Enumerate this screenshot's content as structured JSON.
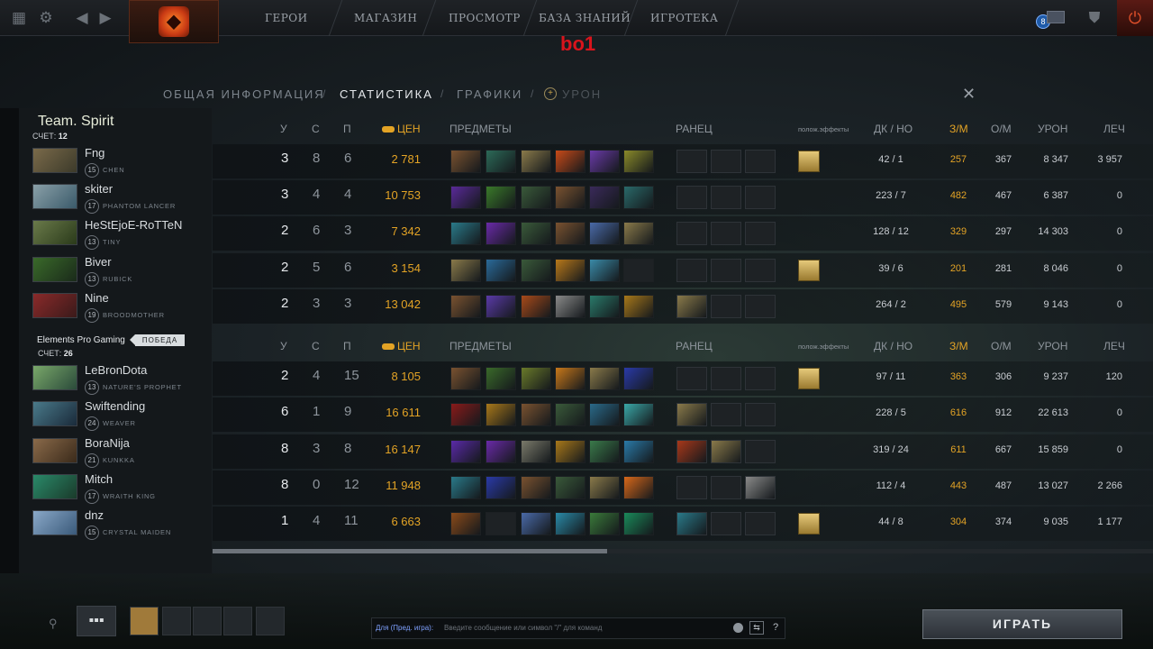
{
  "nav": {
    "items": [
      "ГЕРОИ",
      "МАГАЗИН",
      "ПРОСМОТР",
      "БАЗА ЗНАНИЙ",
      "ИГРОТЕКА"
    ],
    "notification_count": "8"
  },
  "overlay_text": "bo1",
  "tabs": [
    "ОБЩАЯ ИНФОРМАЦИЯ",
    "СТАТИСТИКА",
    "ГРАФИКИ",
    "УРОН"
  ],
  "headers": {
    "k": "У",
    "d": "С",
    "a": "П",
    "nw": "ЦЕН",
    "items": "ПРЕДМЕТЫ",
    "backpack": "РАНЕЦ",
    "effects": "полож.эффекты",
    "lh_dn": "ДК / НО",
    "gpm": "З/М",
    "xpm": "О/М",
    "dmg": "УРОН",
    "heal": "ЛЕЧ"
  },
  "team1": {
    "name": "Team. Spirit",
    "score_label": "СЧЕТ:",
    "score": "12",
    "players": [
      {
        "name": "Fng",
        "level": "15",
        "hero": "CHEN",
        "k": "3",
        "d": "8",
        "a": "6",
        "nw": "2 781",
        "lh": "42",
        "dn": "1",
        "gpm": "257",
        "xpm": "367",
        "dmg": "8 347",
        "heal": "3 957",
        "items": [
          "#7a5230",
          "#2c6a58",
          "#8a7a4a",
          "#c84a18",
          "#6a3aa8",
          "#8a8a2a"
        ],
        "backpack": [
          "",
          "",
          ""
        ],
        "effect": true
      },
      {
        "name": "skiter",
        "level": "17",
        "hero": "PHANTOM LANCER",
        "k": "3",
        "d": "4",
        "a": "4",
        "nw": "10 753",
        "lh": "223",
        "dn": "7",
        "gpm": "482",
        "xpm": "467",
        "dmg": "6 387",
        "heal": "0",
        "items": [
          "#5a2a9a",
          "#3a7a2a",
          "#3a5a3a",
          "#7a5230",
          "#3a2a5a",
          "#2a6a6a"
        ],
        "backpack": [
          "",
          "",
          ""
        ],
        "effect": false
      },
      {
        "name": "HeStEjoE-RoTTeN",
        "level": "13",
        "hero": "TINY",
        "k": "2",
        "d": "6",
        "a": "3",
        "nw": "7 342",
        "lh": "128",
        "dn": "12",
        "gpm": "329",
        "xpm": "297",
        "dmg": "14 303",
        "heal": "0",
        "items": [
          "#2a7a8a",
          "#6a2aa8",
          "#3a5a3a",
          "#7a5230",
          "#4a6aa8",
          "#8a7a4a"
        ],
        "backpack": [
          "",
          "",
          ""
        ],
        "effect": false
      },
      {
        "name": "Biver",
        "level": "13",
        "hero": "RUBICK",
        "k": "2",
        "d": "5",
        "a": "6",
        "nw": "3 154",
        "lh": "39",
        "dn": "6",
        "gpm": "201",
        "xpm": "281",
        "dmg": "8 046",
        "heal": "0",
        "items": [
          "#8a7a4a",
          "#2a6a9a",
          "#3a5a3a",
          "#b8781a",
          "#3a8aa8",
          ""
        ],
        "backpack": [
          "",
          "",
          ""
        ],
        "effect": true
      },
      {
        "name": "Nine",
        "level": "19",
        "hero": "BROODMOTHER",
        "k": "2",
        "d": "3",
        "a": "3",
        "nw": "13 042",
        "lh": "264",
        "dn": "2",
        "gpm": "495",
        "xpm": "579",
        "dmg": "9 143",
        "heal": "0",
        "items": [
          "#7a5230",
          "#5a3aa8",
          "#a84a1a",
          "#8a8a8a",
          "#2a7a6a",
          "#a8781a"
        ],
        "backpack": [
          "#8a7a4a",
          "",
          ""
        ],
        "effect": false
      }
    ]
  },
  "team2": {
    "name": "Elements Pro Gaming",
    "winner_badge": "ПОБЕДА",
    "score_label": "СЧЕТ:",
    "score": "26",
    "players": [
      {
        "name": "LeBronDota",
        "level": "13",
        "hero": "NATURE'S PROPHET",
        "k": "2",
        "d": "4",
        "a": "15",
        "nw": "8 105",
        "lh": "97",
        "dn": "11",
        "gpm": "363",
        "xpm": "306",
        "dmg": "9 237",
        "heal": "120",
        "items": [
          "#7a5230",
          "#3a6a2a",
          "#6a7a2a",
          "#c8781a",
          "#8a7a4a",
          "#2a3aa8"
        ],
        "backpack": [
          "",
          "",
          ""
        ],
        "effect": true
      },
      {
        "name": "Swiftending",
        "level": "24",
        "hero": "WEAVER",
        "k": "6",
        "d": "1",
        "a": "9",
        "nw": "16 611",
        "lh": "228",
        "dn": "5",
        "gpm": "616",
        "xpm": "912",
        "dmg": "22 613",
        "heal": "0",
        "items": [
          "#8a1a1a",
          "#a8781a",
          "#7a5230",
          "#3a5a3a",
          "#2a6a8a",
          "#3aa8a8"
        ],
        "backpack": [
          "#8a7a4a",
          "",
          ""
        ],
        "effect": false
      },
      {
        "name": "BoraNija",
        "level": "21",
        "hero": "KUNKKA",
        "k": "8",
        "d": "3",
        "a": "8",
        "nw": "16 147",
        "lh": "319",
        "dn": "24",
        "gpm": "611",
        "xpm": "667",
        "dmg": "15 859",
        "heal": "0",
        "items": [
          "#5a2aa8",
          "#6a2aa8",
          "#7a7a6a",
          "#a8781a",
          "#3a7a4a",
          "#2a7aa8"
        ],
        "backpack": [
          "#a8381a",
          "#8a7a4a",
          ""
        ],
        "effect": false
      },
      {
        "name": "Mitch",
        "level": "17",
        "hero": "WRAITH KING",
        "k": "8",
        "d": "0",
        "a": "12",
        "nw": "11 948",
        "lh": "112",
        "dn": "4",
        "gpm": "443",
        "xpm": "487",
        "dmg": "13 027",
        "heal": "2 266",
        "items": [
          "#2a7a8a",
          "#2a3aa8",
          "#7a5230",
          "#3a5a3a",
          "#8a7a4a",
          "#d8681a"
        ],
        "backpack": [
          "",
          "",
          "#8a8a8a"
        ],
        "effect": false
      },
      {
        "name": "dnz",
        "level": "15",
        "hero": "CRYSTAL MAIDEN",
        "k": "1",
        "d": "4",
        "a": "11",
        "nw": "6 663",
        "lh": "44",
        "dn": "8",
        "gpm": "304",
        "xpm": "374",
        "dmg": "9 035",
        "heal": "1 177",
        "items": [
          "#8a4a1a",
          "",
          "#4a6aa8",
          "#2a8aa8",
          "#3a7a3a",
          "#1a8a5a"
        ],
        "backpack": [
          "#2a7a8a",
          "",
          ""
        ],
        "effect": true
      }
    ]
  },
  "chat": {
    "prefix": "Для (Пред. игра):",
    "placeholder": "Введите сообщение или символ \"/\" для команд"
  },
  "play_button": "ИГРАТЬ"
}
